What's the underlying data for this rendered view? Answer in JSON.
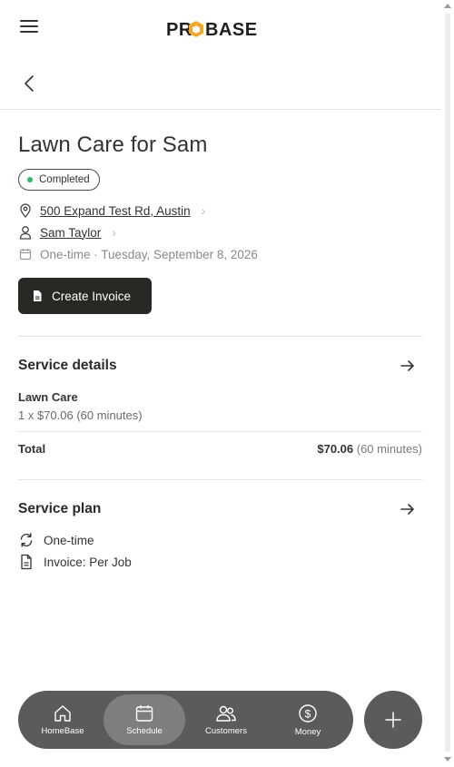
{
  "app": {
    "logo_text": "PROBASE"
  },
  "job": {
    "title": "Lawn Care for Sam",
    "status": "Completed",
    "address": "500 Expand Test Rd, Austin",
    "customer": "Sam Taylor",
    "schedule": "One-time · Tuesday, September 8, 2026"
  },
  "actions": {
    "create_invoice": "Create Invoice"
  },
  "service_details": {
    "title": "Service details",
    "item_name": "Lawn Care",
    "item_detail": "1 x $70.06 (60 minutes)",
    "total_label": "Total",
    "total_amount": "$70.06",
    "total_duration": "(60 minutes)"
  },
  "service_plan": {
    "title": "Service plan",
    "frequency": "One-time",
    "invoice": "Invoice: Per Job"
  },
  "nav": {
    "items": [
      {
        "label": "HomeBase",
        "icon": "home-icon"
      },
      {
        "label": "Schedule",
        "icon": "calendar-icon"
      },
      {
        "label": "Customers",
        "icon": "users-icon"
      },
      {
        "label": "Money",
        "icon": "dollar-icon"
      }
    ],
    "active": "Schedule"
  },
  "colors": {
    "status_dot": "#2fb867",
    "primary_button": "#2a2825",
    "nav_bg": "#5b5b5b"
  }
}
